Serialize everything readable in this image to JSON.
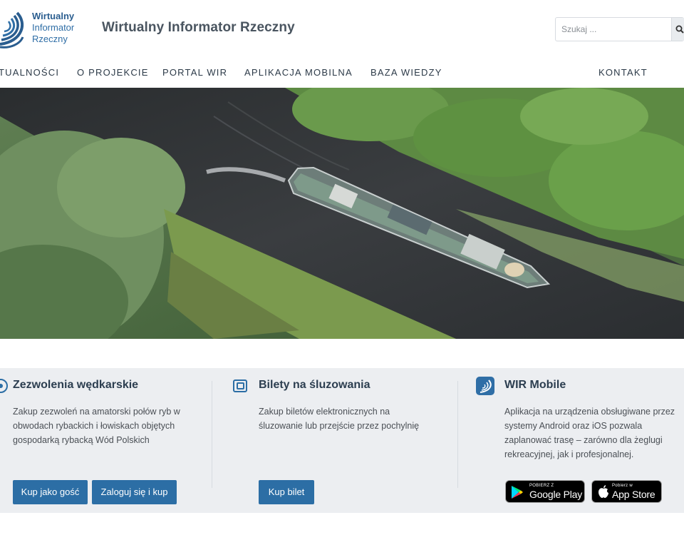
{
  "header": {
    "logo": {
      "line1": "Wirtualny",
      "line2": "Informator",
      "line3": "Rzeczny"
    },
    "site_title": "Wirtualny Informator Rzeczny",
    "search": {
      "placeholder": "Szukaj ..."
    }
  },
  "nav": {
    "items": [
      "TUALNOŚCI",
      "O PROJEKCIE",
      "PORTAL WIR",
      "APLIKACJA MOBILNA",
      "BAZA WIEDZY"
    ],
    "contact": "KONTAKT"
  },
  "hero": {
    "icon": "river-boat-aerial-photo"
  },
  "cards": {
    "fishing": {
      "title": "Zezwolenia wędkarskie",
      "lines": [
        "Zakup zezwoleń na amatorski połów ryb w",
        "obwodach rybackich i łowiskach objętych",
        "gospodarką rybacką Wód Polskich"
      ],
      "guest_button": "Kup jako gość",
      "login_button": "Zaloguj się i kup"
    },
    "locks": {
      "title": "Bilety na śluzowania",
      "lines": [
        "Zakup biletów elektronicznych na",
        "śluzowanie lub przejście przez pochylnię"
      ],
      "buy_button": "Kup bilet"
    },
    "mobile": {
      "title": "WIR Mobile",
      "lines": [
        "Aplikacja na urządzenia obsługiwane przez",
        "systemy Android oraz iOS pozwala",
        "zaplanować trasę – zarówno dla żeglugi",
        "rekreacyjnej, jak i profesjonalnej."
      ],
      "google_small": "POBIERZ Z",
      "google_big": "Google Play",
      "apple_small": "Pobierz w",
      "apple_big": "App Store"
    }
  },
  "colors": {
    "accent": "#2c6ea5",
    "cards_bg": "#eceef1",
    "logo_blue": "#2a5d8f"
  }
}
